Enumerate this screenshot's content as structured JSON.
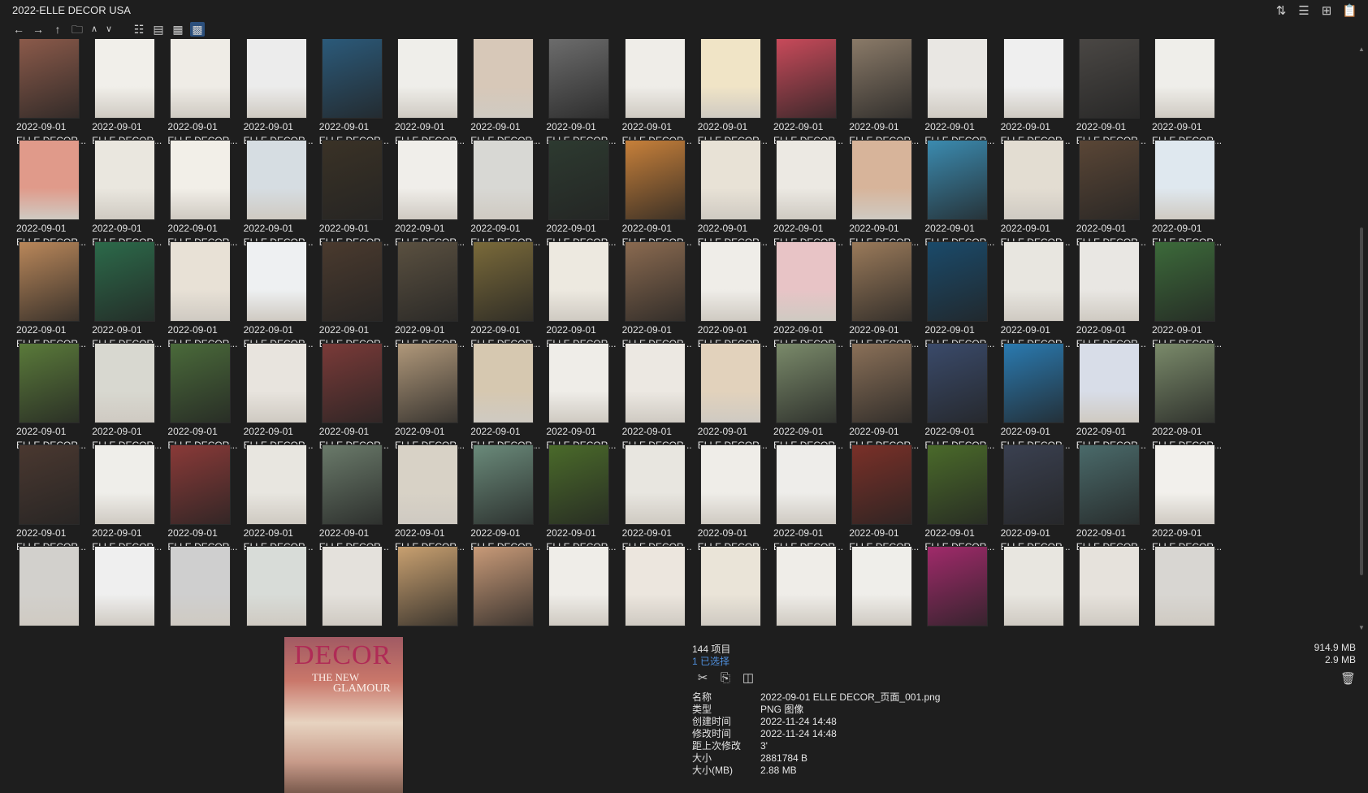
{
  "window": {
    "title": "2022-ELLE DECOR USA"
  },
  "title_icons": [
    {
      "name": "sort-icon",
      "glyph": "⇅"
    },
    {
      "name": "details-icon",
      "glyph": "☰"
    },
    {
      "name": "add-icon",
      "glyph": "⊞"
    },
    {
      "name": "clipboard-icon",
      "glyph": "📋"
    }
  ],
  "toolbar": [
    {
      "name": "back-icon",
      "glyph": "←"
    },
    {
      "name": "forward-icon",
      "glyph": "→"
    },
    {
      "name": "up-icon",
      "glyph": "↑"
    },
    {
      "name": "folder-icon",
      "glyph": "🗀"
    },
    {
      "name": "chevron-up-icon",
      "glyph": "∧"
    },
    {
      "name": "chevron-down-icon",
      "glyph": "∨"
    },
    {
      "name": "list-view-icon",
      "glyph": "☷"
    },
    {
      "name": "compact-view-icon",
      "glyph": "▤"
    },
    {
      "name": "detail-view-icon",
      "glyph": "▦"
    },
    {
      "name": "thumbnail-view-icon",
      "glyph": "▩",
      "active": true
    }
  ],
  "tiles": {
    "date": "2022-09-01",
    "name": "ELLE DECOR...",
    "columns": 16,
    "full_rows": 5,
    "partial_row_count": 16
  },
  "tile_colors": [
    "#8b5a4a",
    "#f1efea",
    "#efece6",
    "#ececec",
    "#2b5a7a",
    "#efeeea",
    "#d7c8b8",
    "#6c6c6c",
    "#efede8",
    "#f0e4c6",
    "#c84a5a",
    "#8a7a68",
    "#e9e7e3",
    "#efefef",
    "#4a4744",
    "#efeeea",
    "#e09a8a",
    "#eae7df",
    "#f2efe8",
    "#d6dde2",
    "#3a3226",
    "#f0eeea",
    "#d8d8d4",
    "#2d3a30",
    "#c7803a",
    "#e8e2d6",
    "#ece9e3",
    "#d7b49a",
    "#3b8bb0",
    "#e3ddd2",
    "#5a4636",
    "#dfe8ef",
    "#b9875a",
    "#2c6a4a",
    "#e8e1d6",
    "#eef0f2",
    "#4a3a2e",
    "#5a5040",
    "#7a6a3a",
    "#ede9e0",
    "#8a6a50",
    "#efede8",
    "#e8c4c6",
    "#9a7a5a",
    "#1a4a6a",
    "#e8e6e0",
    "#e9e7e3",
    "#3c6a3a",
    "#5a7a3a",
    "#d8d8d0",
    "#4a6a3a",
    "#e8e4de",
    "#7a3a38",
    "#b0987a",
    "#d6c8b0",
    "#efede8",
    "#ece8e2",
    "#e2d2bc",
    "#7a8a6a",
    "#8a7058",
    "#3a4a6a",
    "#2a7ab0",
    "#d8dde8",
    "#7a8a6a",
    "#4a3830",
    "#efeeea",
    "#8a3a38",
    "#e8e6e0",
    "#6a7a6a",
    "#d8d2c6",
    "#6a8a7a",
    "#4a6a2a",
    "#e8e6e0",
    "#efede8",
    "#eeedea",
    "#7a3028",
    "#4a6a2a",
    "#3a4050",
    "#4a6a6a",
    "#f2f0ec",
    "#d2d0cc",
    "#efefef",
    "#cfcfcf",
    "#d8dcd8",
    "#e4e1dc",
    "#c8a070",
    "#c89a78",
    "#efede8",
    "#ece6de",
    "#eae4d8",
    "#efede8",
    "#efeeea",
    "#a02a6a",
    "#e8e6e0",
    "#e6e2dc",
    "#d8d6d2"
  ],
  "preview": {
    "brand": "DECOR",
    "headline_1": "THE NEW",
    "headline_2": "GLAMOUR"
  },
  "status": {
    "count": "144 项目",
    "selected": "1 已选择",
    "total_size": "914.9 MB",
    "selected_size": "2.9 MB"
  },
  "actions": [
    {
      "name": "cut-icon",
      "glyph": "✂"
    },
    {
      "name": "copy-icon",
      "glyph": "⎘"
    },
    {
      "name": "compare-icon",
      "glyph": "◫"
    }
  ],
  "properties": [
    {
      "key": "名称",
      "value": "2022-09-01 ELLE DECOR_页面_001.png"
    },
    {
      "key": "类型",
      "value": "PNG 图像"
    },
    {
      "key": "创建时间",
      "value": "2022-11-24  14:48"
    },
    {
      "key": "修改时间",
      "value": "2022-11-24  14:48"
    },
    {
      "key": "距上次修改",
      "value": "3'"
    },
    {
      "key": "大小",
      "value": "2881784 B"
    },
    {
      "key": "大小(MB)",
      "value": "2.88 MB"
    }
  ]
}
